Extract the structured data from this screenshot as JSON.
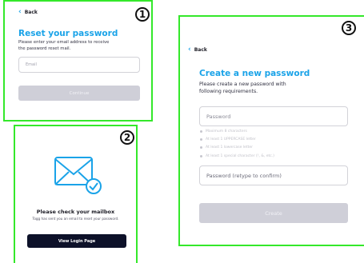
{
  "badges": [
    "1",
    "2",
    "3"
  ],
  "reset": {
    "back": "Back",
    "title": "Reset your password",
    "subtitle_line1": "Please enter your email address to receive",
    "subtitle_line2": "the password reset mail.",
    "email_placeholder": "Email",
    "continue": "Continue"
  },
  "mailbox": {
    "title": "Please check your mailbox",
    "message": "Togg has sent you an email to reset your password.",
    "button": "View Login Page"
  },
  "create": {
    "back": "Back",
    "title": "Create a new password",
    "subtitle_line1": "Please create a new password with",
    "subtitle_line2": "following requirements.",
    "password_placeholder": "Password",
    "requirements": [
      "Maximum 8 characters",
      "At least 1 UPPERCASE letter",
      "At least 1 lowercase letter",
      "At least 1 special character (!, &, etc.)"
    ],
    "confirm_placeholder": "Password (retype to confirm)",
    "create_button": "Create"
  },
  "colors": {
    "accent": "#1aa3e8",
    "highlight_border": "#34e82a",
    "dark_button": "#0d1129",
    "disabled_button": "#cfcfd8"
  },
  "icons": {
    "back": "chevron-left-icon",
    "mail": "envelope-check-icon"
  }
}
